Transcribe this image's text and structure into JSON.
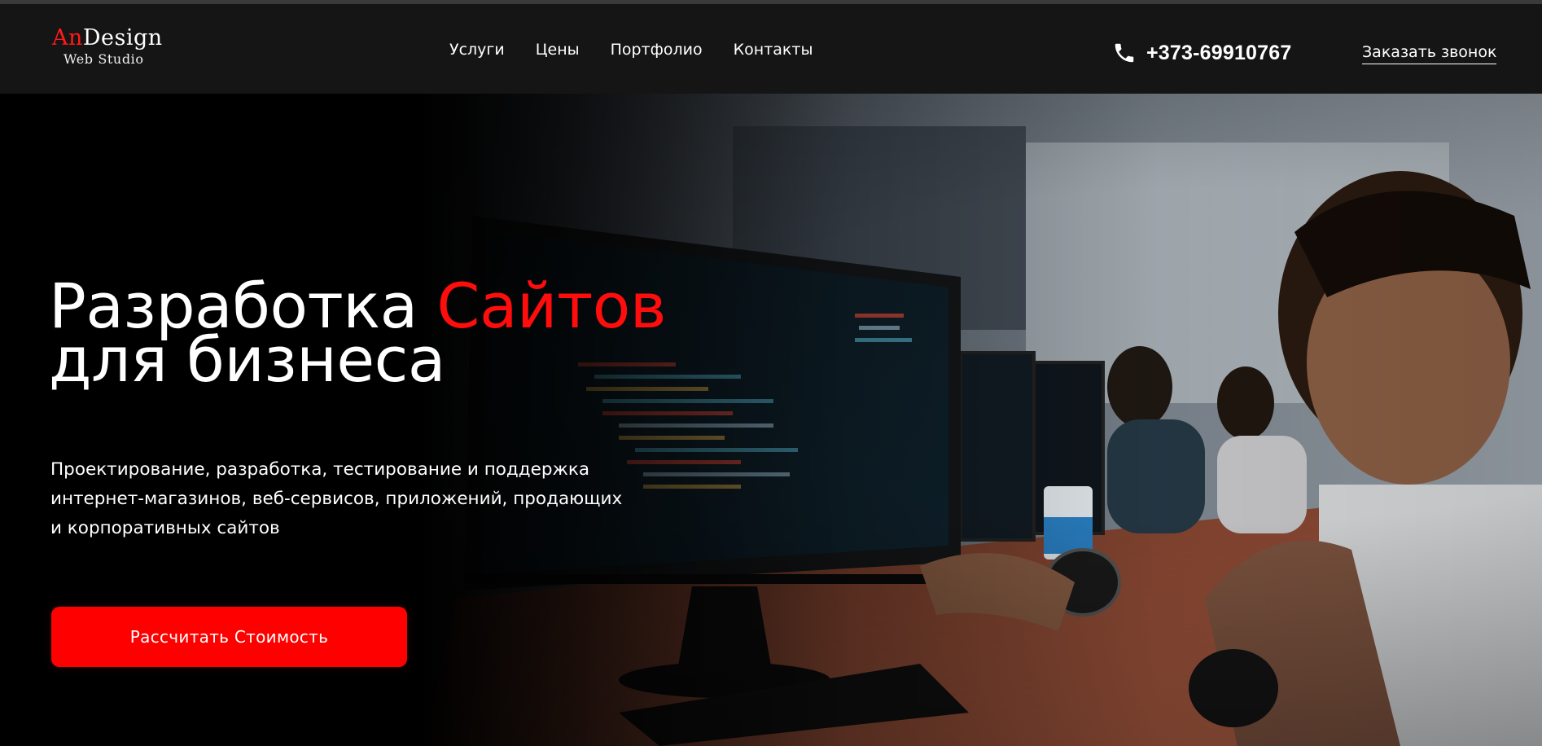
{
  "header": {
    "logo": {
      "part_red": "An",
      "part_white": "Design",
      "subtitle": "Web Studio"
    },
    "nav": [
      {
        "label": "Услуги"
      },
      {
        "label": "Цены"
      },
      {
        "label": "Портфолио"
      },
      {
        "label": "Контакты"
      }
    ],
    "phone": {
      "icon": "phone-icon",
      "number": "+373-69910767"
    },
    "callback_label": "Заказать звонок"
  },
  "hero": {
    "title_line1_white": "Разработка ",
    "title_line1_red": "Сайтов",
    "title_line2": "для бизнеса",
    "description_lines": [
      "Проектирование, разработка, тестирование и поддержка",
      "интернет-магазинов, веб-сервисов, приложений, продающих",
      "и корпоративных сайтов"
    ],
    "cta_label": "Рассчитать Стоимость"
  },
  "colors": {
    "accent": "#ff0000",
    "header_bg": "#151515",
    "hero_bg": "#000000",
    "text": "#ffffff"
  }
}
